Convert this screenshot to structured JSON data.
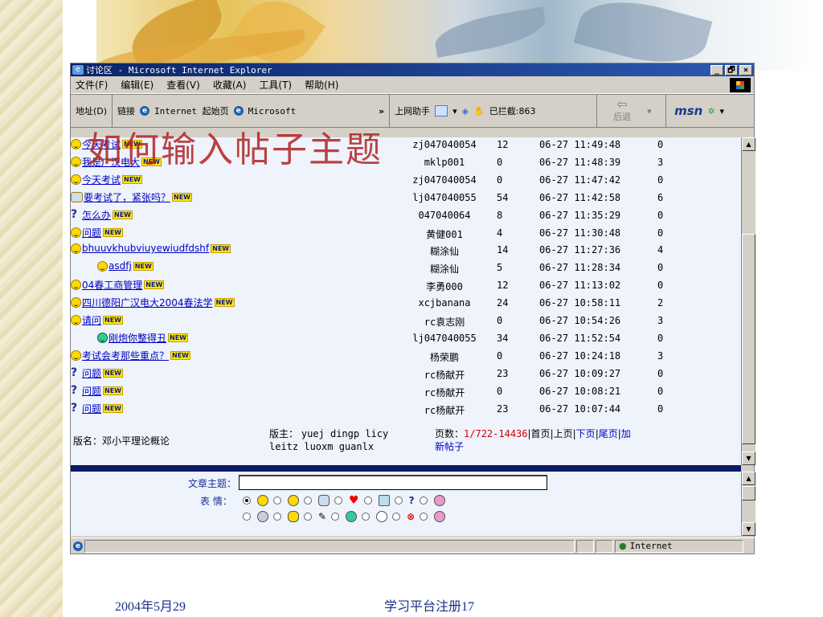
{
  "slide": {
    "overlay_title": "如何输入帖子主题",
    "footer_date": "2004年5月29",
    "footer_text": "学习平台注册17"
  },
  "window": {
    "title": "讨论区 - Microsoft Internet Explorer",
    "buttons": [
      "_",
      "🗗",
      "×"
    ]
  },
  "menu": [
    "文件(F)",
    "编辑(E)",
    "查看(V)",
    "收藏(A)",
    "工具(T)",
    "帮助(H)"
  ],
  "addressbar": {
    "address_label": "地址(D)",
    "links_label": "链接",
    "link1": "Internet 起始页",
    "link2": "Microsoft",
    "assistant": "上网助手",
    "blocked": "已拦截:863",
    "back": "后退",
    "msn": "msn"
  },
  "forum": {
    "rows": [
      {
        "title": "今天考试",
        "icon": "smile",
        "indent": false,
        "author": "zj047040054",
        "replies": "12",
        "time": "06-27 11:49:48",
        "views": "0"
      },
      {
        "title": "我是广汉电大",
        "icon": "smile",
        "indent": false,
        "author": "mklp001",
        "replies": "0",
        "time": "06-27 11:48:39",
        "views": "3"
      },
      {
        "title": "今天考试",
        "icon": "smile",
        "indent": false,
        "author": "zj047040054",
        "replies": "0",
        "time": "06-27 11:47:42",
        "views": "0"
      },
      {
        "title": "要考试了，紧张吗？",
        "icon": "pencil",
        "indent": false,
        "author": "lj047040055",
        "replies": "54",
        "time": "06-27 11:42:58",
        "views": "6"
      },
      {
        "title": "怎么办",
        "icon": "question",
        "indent": false,
        "author": "047040064",
        "replies": "8",
        "time": "06-27 11:35:29",
        "views": "0"
      },
      {
        "title": "问题",
        "icon": "smile",
        "indent": false,
        "author": "黄健001",
        "replies": "4",
        "time": "06-27 11:30:48",
        "views": "0"
      },
      {
        "title": "bhuuvkhubviuyewiudfdshf",
        "icon": "smile",
        "indent": false,
        "author": "糊涂仙",
        "replies": "14",
        "time": "06-27 11:27:36",
        "views": "4"
      },
      {
        "title": "asdfj",
        "icon": "smile",
        "indent": true,
        "author": "糊涂仙",
        "replies": "5",
        "time": "06-27 11:28:34",
        "views": "0"
      },
      {
        "title": "04春工商管理",
        "icon": "smile",
        "indent": false,
        "author": "李勇000",
        "replies": "12",
        "time": "06-27 11:13:02",
        "views": "0"
      },
      {
        "title": "四川德阳广汉电大2004春法学",
        "icon": "smile",
        "indent": false,
        "author": "xcjbanana",
        "replies": "24",
        "time": "06-27 10:58:11",
        "views": "2"
      },
      {
        "title": "请问",
        "icon": "smile",
        "indent": false,
        "author": "rc袁志刚",
        "replies": "0",
        "time": "06-27 10:54:26",
        "views": "3"
      },
      {
        "title": "刚炮你整得丑",
        "icon": "grin",
        "indent": true,
        "author": "lj047040055",
        "replies": "34",
        "time": "06-27 11:52:54",
        "views": "0"
      },
      {
        "title": "考试会考那些重点？",
        "icon": "smile",
        "indent": false,
        "author": "杨荣鹏",
        "replies": "0",
        "time": "06-27 10:24:18",
        "views": "3"
      },
      {
        "title": "问题",
        "icon": "question",
        "indent": false,
        "author": "rc杨献开",
        "replies": "23",
        "time": "06-27 10:09:27",
        "views": "0"
      },
      {
        "title": "问题",
        "icon": "question",
        "indent": false,
        "author": "rc杨献开",
        "replies": "0",
        "time": "06-27 10:08:21",
        "views": "0"
      },
      {
        "title": "问题",
        "icon": "question",
        "indent": false,
        "author": "rc杨献开",
        "replies": "23",
        "time": "06-27 10:07:44",
        "views": "0"
      }
    ],
    "new_badge": "NEW",
    "board_name": "版名：邓小平理论概论",
    "moderators_label": "版主：",
    "moderators_line1": "yuej dingp licy",
    "moderators_line2": "leitz luoxm guanlx",
    "pages_label": "页数：",
    "pages_value": "1/722-14436",
    "pager_first": "首页",
    "pager_prev": "上页",
    "pager_next": "下页",
    "pager_last": "尾页",
    "pager_add_1": "加",
    "pager_add_2": "新帖子"
  },
  "post_form": {
    "subject_label": "文章主题：",
    "subject_value": "",
    "mood_label": "表 情："
  },
  "status": {
    "zone": "Internet"
  }
}
